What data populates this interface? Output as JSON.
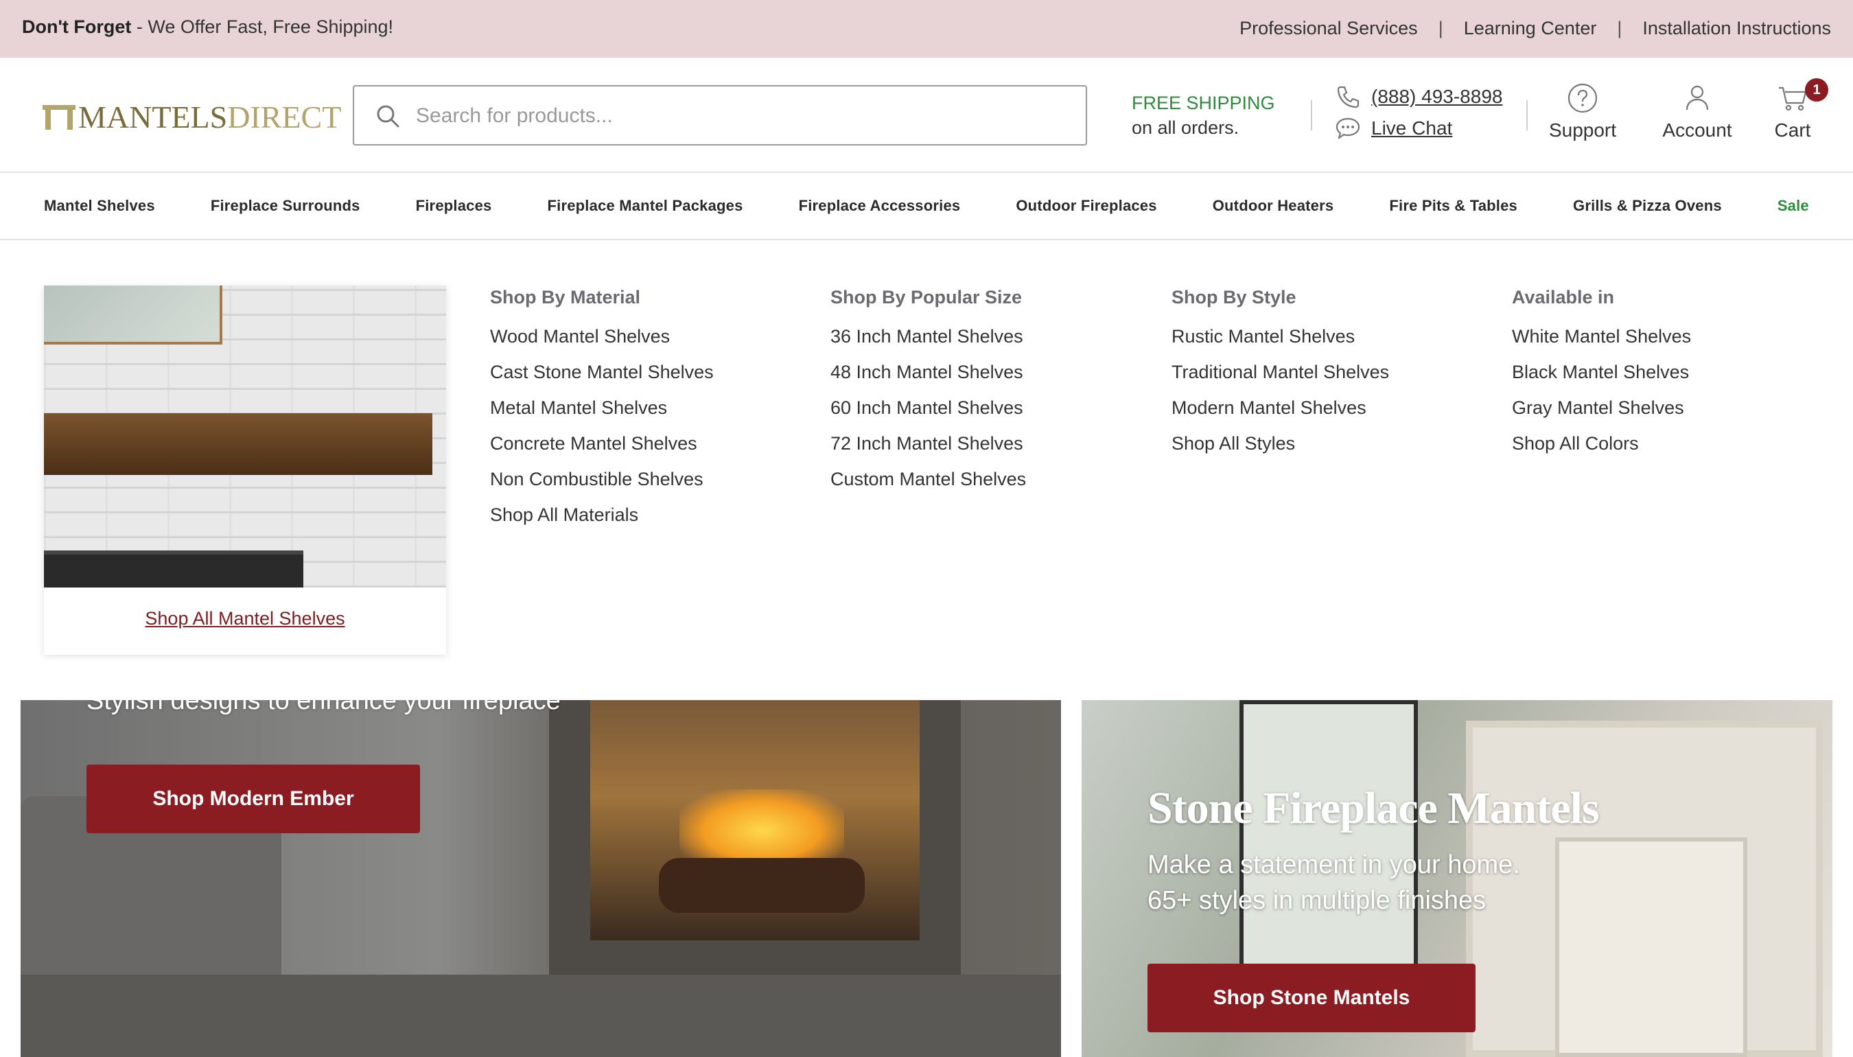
{
  "topbar": {
    "promo_bold": "Don't Forget",
    "promo_text": " - We Offer Fast, Free Shipping!",
    "links": [
      "Professional Services",
      "Learning Center",
      "Installation Instructions"
    ]
  },
  "header": {
    "logo_part1": "MANTELS",
    "logo_part2": "DIRECT",
    "search_placeholder": "Search for products...",
    "shipping_line1": "FREE SHIPPING",
    "shipping_line2": "on all orders.",
    "phone": "(888) 493-8898",
    "live_chat": "Live Chat",
    "support_label": "Support",
    "account_label": "Account",
    "cart_label": "Cart",
    "cart_count": "1"
  },
  "nav": {
    "items": [
      "Mantel Shelves",
      "Fireplace Surrounds",
      "Fireplaces",
      "Fireplace Mantel Packages",
      "Fireplace Accessories",
      "Outdoor Fireplaces",
      "Outdoor Heaters",
      "Fire Pits & Tables",
      "Grills & Pizza Ovens",
      "Sale"
    ]
  },
  "megamenu": {
    "promo_link": "Shop All Mantel Shelves",
    "columns": [
      {
        "heading": "Shop By Material",
        "links": [
          "Wood Mantel Shelves",
          "Cast Stone Mantel Shelves",
          "Metal Mantel Shelves",
          "Concrete Mantel Shelves",
          "Non Combustible Shelves",
          "Shop All Materials"
        ]
      },
      {
        "heading": "Shop By Popular Size",
        "links": [
          "36 Inch Mantel Shelves",
          "48 Inch Mantel Shelves",
          "60 Inch Mantel Shelves",
          "72 Inch Mantel Shelves",
          "Custom Mantel Shelves"
        ]
      },
      {
        "heading": "Shop By Style",
        "links": [
          "Rustic Mantel Shelves",
          "Traditional Mantel Shelves",
          "Modern Mantel Shelves",
          "Shop All Styles"
        ]
      },
      {
        "heading": "Available in",
        "links": [
          "White Mantel Shelves",
          "Black Mantel Shelves",
          "Gray Mantel Shelves",
          "Shop All Colors"
        ]
      }
    ]
  },
  "hero": {
    "left_subtitle": "Stylish designs to enhance your fireplace",
    "left_cta": "Shop Modern Ember",
    "right_title": "Stone Fireplace Mantels",
    "right_sub1": "Make a statement in your home.",
    "right_sub2": "65+ styles in multiple finishes",
    "right_cta": "Shop Stone Mantels"
  },
  "colors": {
    "topbar_bg": "#e8d3d6",
    "brand_red": "#8b1c22",
    "shipping_green": "#2e8b3e",
    "logo_gold": "#b3a46a"
  }
}
